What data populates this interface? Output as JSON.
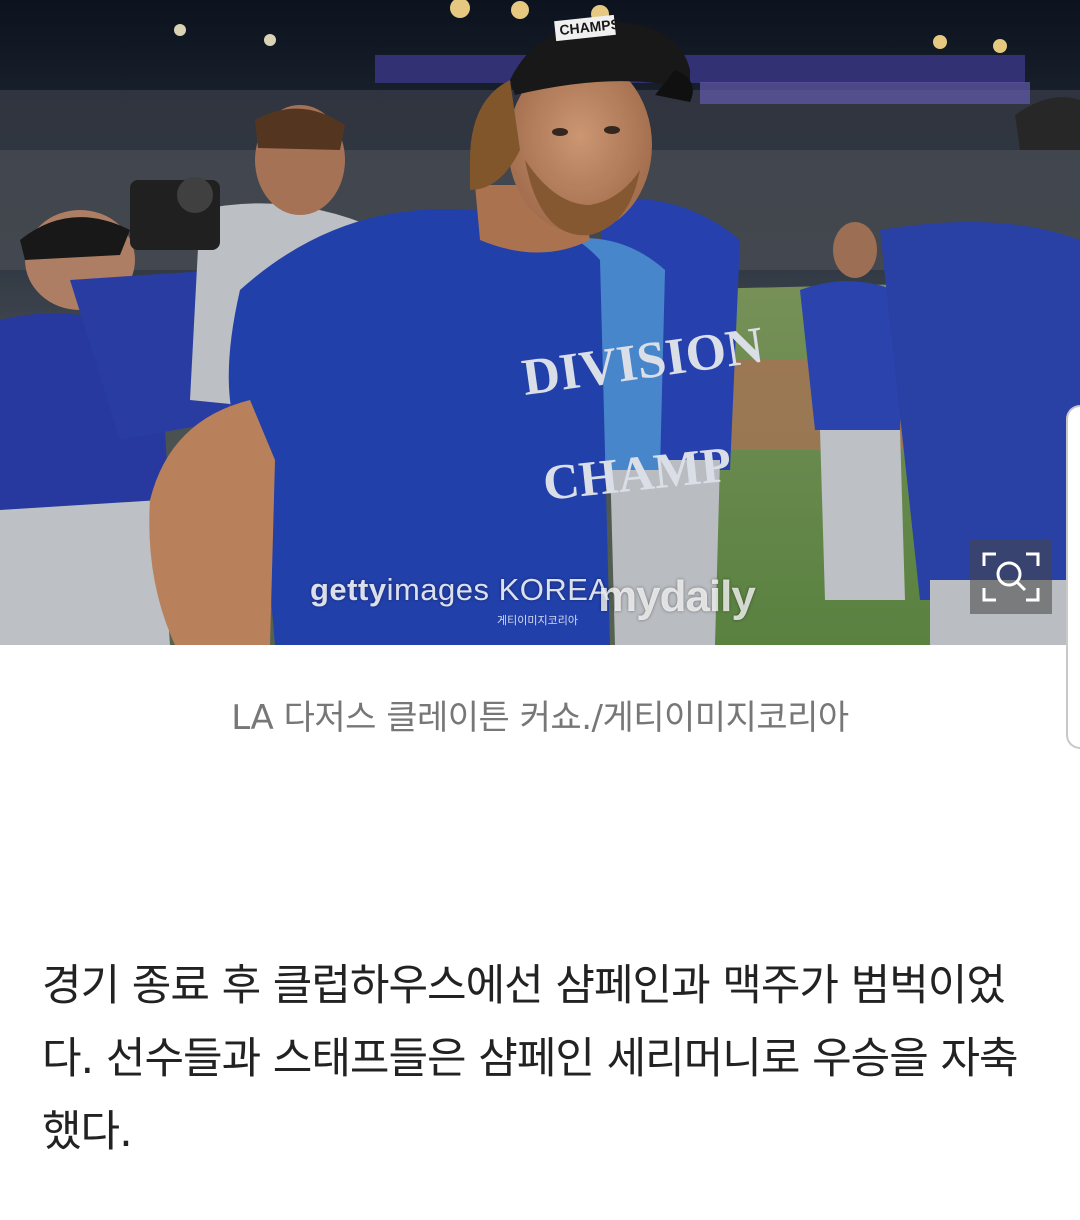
{
  "photo": {
    "alt_icon": "photo-image",
    "watermark_primary_bold": "getty",
    "watermark_primary": "images KOREA",
    "watermark_sub": "게티이미지코리아",
    "watermark_brand": "mydaily",
    "shirt_text_1": "DIVISION",
    "shirt_text_2": "CHAMP",
    "cap_text": "CHAMPS",
    "zoom_icon": "zoom-in-icon"
  },
  "caption": "LA 다저스 클레이튼 커쇼./게티이미지코리아",
  "article": {
    "paragraph": "경기 종료 후 클럽하우스에선 샴페인과 맥주가 범벅이었다. 선수들과 스태프들은 샴페인 세리머니로 우승을 자축했다."
  },
  "colors": {
    "dodger_blue": "#1f45b8",
    "caption_gray": "#777777",
    "body_text": "#222222"
  }
}
